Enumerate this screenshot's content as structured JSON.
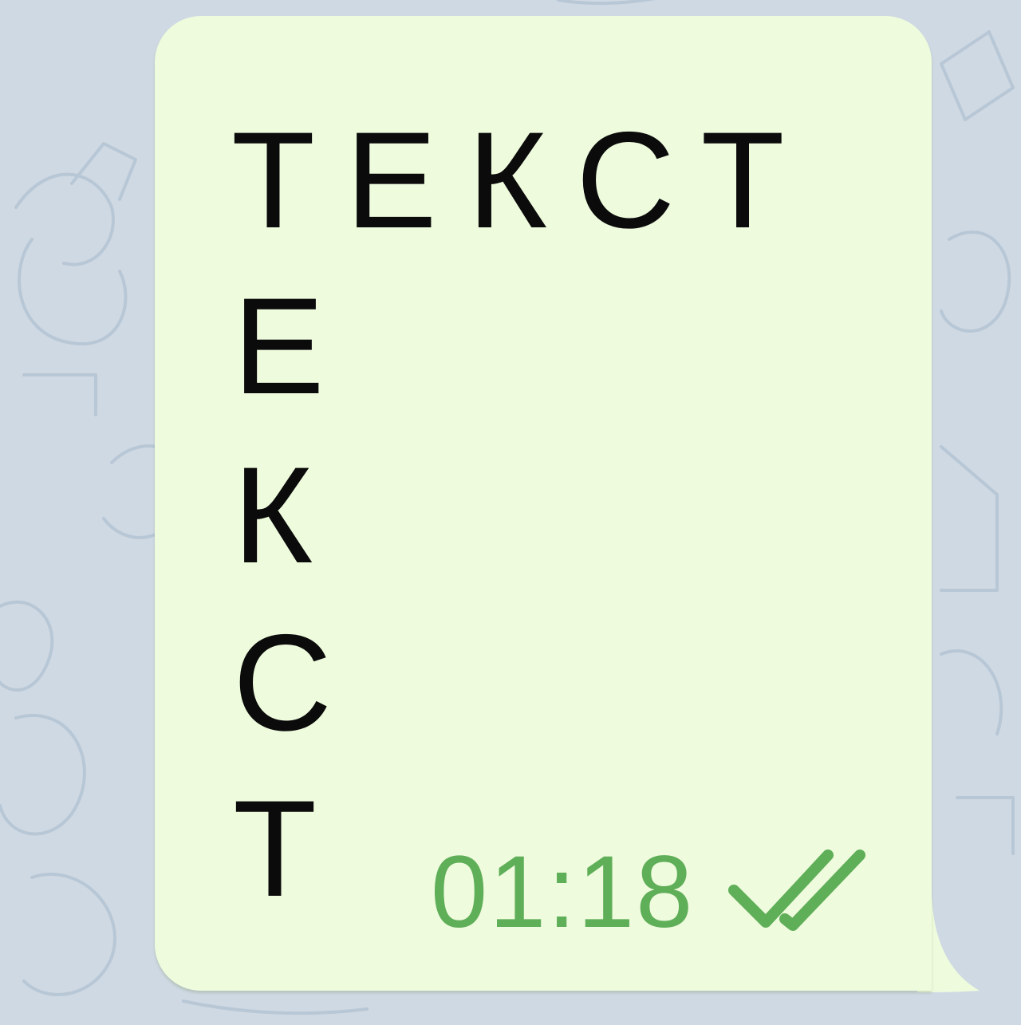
{
  "message": {
    "top_row": "ТЕКСТ",
    "column_letters": [
      "Е",
      "К",
      "С",
      "Т"
    ],
    "time": "01:18",
    "status_icon": "double-check-read-icon"
  },
  "colors": {
    "chat_background": "#cfd9e3",
    "bubble_background": "#eefbdd",
    "text": "#0b0b0b",
    "meta_green": "#5fae58"
  }
}
